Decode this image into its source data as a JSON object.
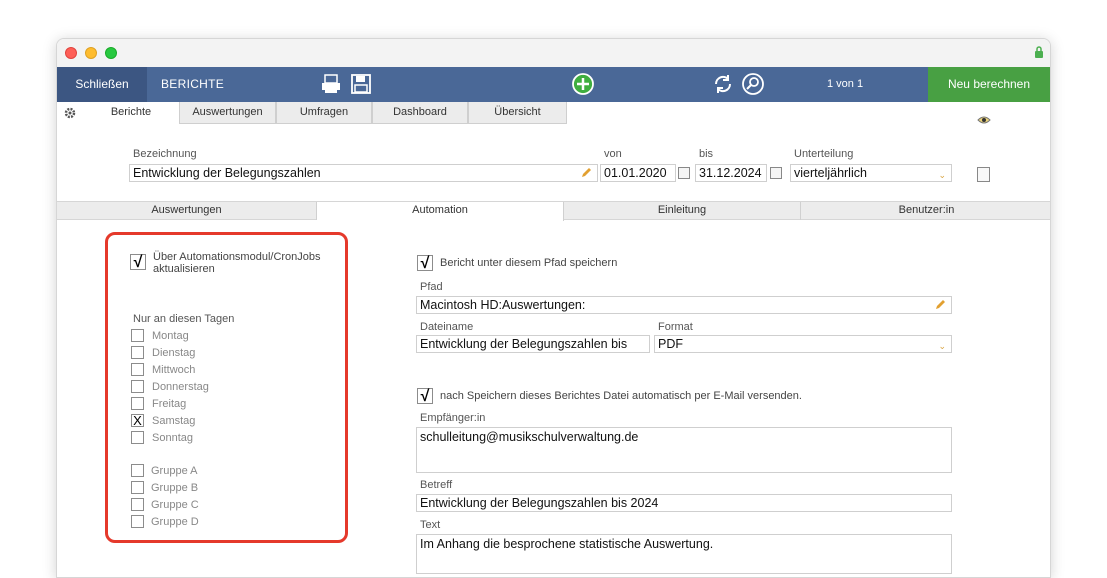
{
  "toolbar": {
    "close_label": "Schließen",
    "title": "BERICHTE",
    "pager": "1 von 1",
    "recalc_label": "Neu berechnen"
  },
  "tabs": [
    "Berichte",
    "Auswertungen",
    "Umfragen",
    "Dashboard",
    "Übersicht"
  ],
  "report": {
    "name_label": "Bezeichnung",
    "name_value": "Entwicklung der Belegungszahlen",
    "from_label": "von",
    "from_value": "01.01.2020",
    "to_label": "bis",
    "to_value": "31.12.2024",
    "division_label": "Unterteilung",
    "division_value": "vierteljährlich"
  },
  "subtabs": [
    "Auswertungen",
    "Automation",
    "Einleitung",
    "Benutzer:in"
  ],
  "automation": {
    "cron_label_line1": "Über Automationsmodul/CronJobs",
    "cron_label_line2": "aktualisieren",
    "cron_checked": "√",
    "days_header": "Nur an diesen Tagen",
    "days": [
      {
        "label": "Montag",
        "mark": ""
      },
      {
        "label": "Dienstag",
        "mark": ""
      },
      {
        "label": "Mittwoch",
        "mark": ""
      },
      {
        "label": "Donnerstag",
        "mark": ""
      },
      {
        "label": "Freitag",
        "mark": ""
      },
      {
        "label": "Samstag",
        "mark": "X"
      },
      {
        "label": "Sonntag",
        "mark": ""
      }
    ],
    "groups": [
      {
        "label": "Gruppe A",
        "mark": ""
      },
      {
        "label": "Gruppe B",
        "mark": ""
      },
      {
        "label": "Gruppe C",
        "mark": ""
      },
      {
        "label": "Gruppe D",
        "mark": ""
      }
    ]
  },
  "save": {
    "save_check": "√",
    "save_label": "Bericht unter diesem Pfad speichern",
    "path_label": "Pfad",
    "path_value": "Macintosh HD:Auswertungen:",
    "filename_label": "Dateiname",
    "filename_value": "Entwicklung der Belegungszahlen bis",
    "format_label": "Format",
    "format_value": "PDF",
    "mail_check": "√",
    "mail_label": "nach Speichern dieses Berichtes Datei automatisch per E-Mail versenden.",
    "recipient_label": "Empfänger:in",
    "recipient_value": "schulleitung@musikschulverwaltung.de",
    "subject_label": "Betreff",
    "subject_value": "Entwicklung der Belegungszahlen bis 2024",
    "text_label": "Text",
    "text_value": "Im Anhang die besprochene statistische Auswertung."
  },
  "colors": {
    "toolbar": "#4a6897",
    "recalc": "#48a043",
    "highlight": "#e5392b"
  }
}
